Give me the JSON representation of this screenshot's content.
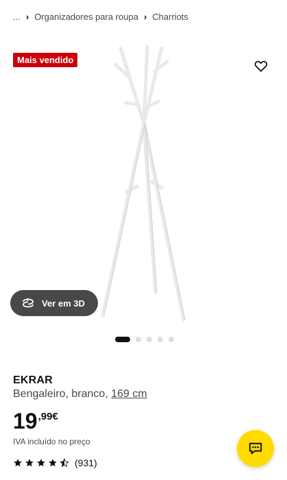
{
  "breadcrumb": {
    "ellipsis": "...",
    "items": [
      "Organizadores para roupa",
      "Charriots"
    ]
  },
  "badge": {
    "label": "Mais vendido",
    "color": "#cc0008"
  },
  "gallery": {
    "view3d_label": "Ver em 3D",
    "slide_count": 5,
    "active_slide": 1
  },
  "product": {
    "name": "EKRAR",
    "description": "Bengaleiro, branco,",
    "size": "169 cm",
    "price_integer": "19",
    "price_decimal": ",99",
    "currency": "€",
    "vat_note": "IVA incluído no preço",
    "rating": 4.5,
    "reviews": "(931)"
  },
  "icons": {
    "favourite": "heart-outline-icon",
    "view3d": "rotate-3d-icon",
    "chat": "chat-bubble-icon",
    "breadcrumb_separator": "chevron-right-icon"
  },
  "colors": {
    "accent_yellow": "#ffdb00",
    "text": "#111111",
    "muted": "#484848"
  }
}
